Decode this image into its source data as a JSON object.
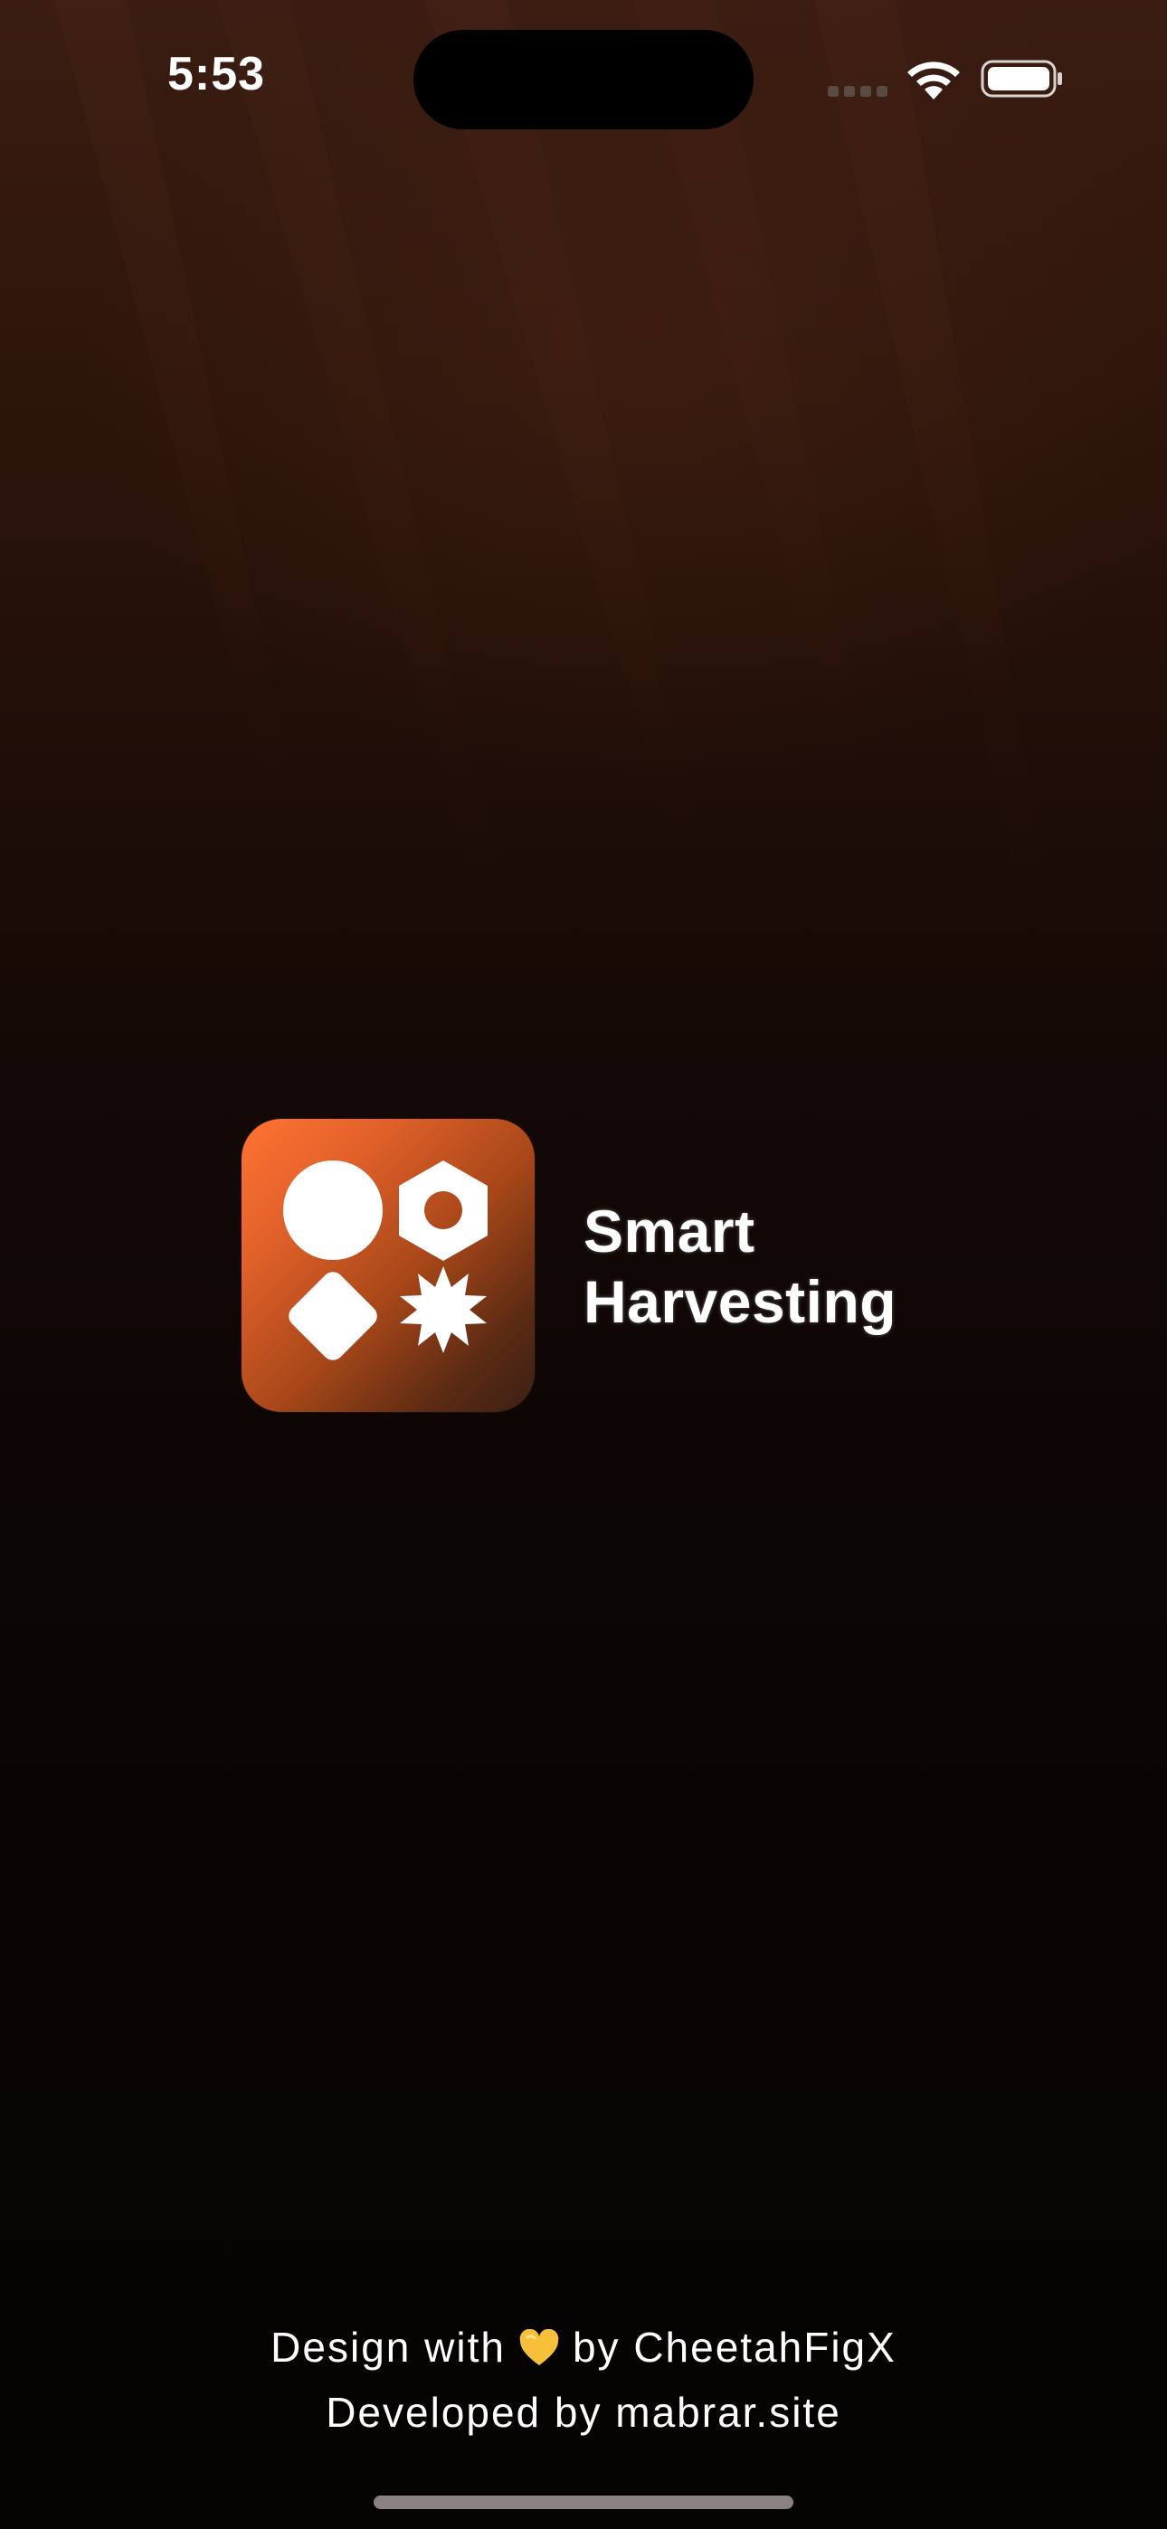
{
  "status_bar": {
    "time": "5:53"
  },
  "app": {
    "name_line1": "Smart",
    "name_line2": "Harvesting",
    "logo_icons": [
      "circle-icon",
      "hex-nut-icon",
      "diamond-icon",
      "starburst-icon"
    ]
  },
  "credits": {
    "design_prefix": "Design with",
    "heart_icon": "yellow-heart-icon",
    "design_suffix": "by CheetahFigX",
    "developed": "Developed by mabrar.site"
  },
  "colors": {
    "logo_gradient_start": "#ff7433",
    "logo_gradient_end": "#3a2016",
    "background_top": "#3a1c12",
    "background_bottom": "#060303",
    "heart": "#f7c03a"
  }
}
